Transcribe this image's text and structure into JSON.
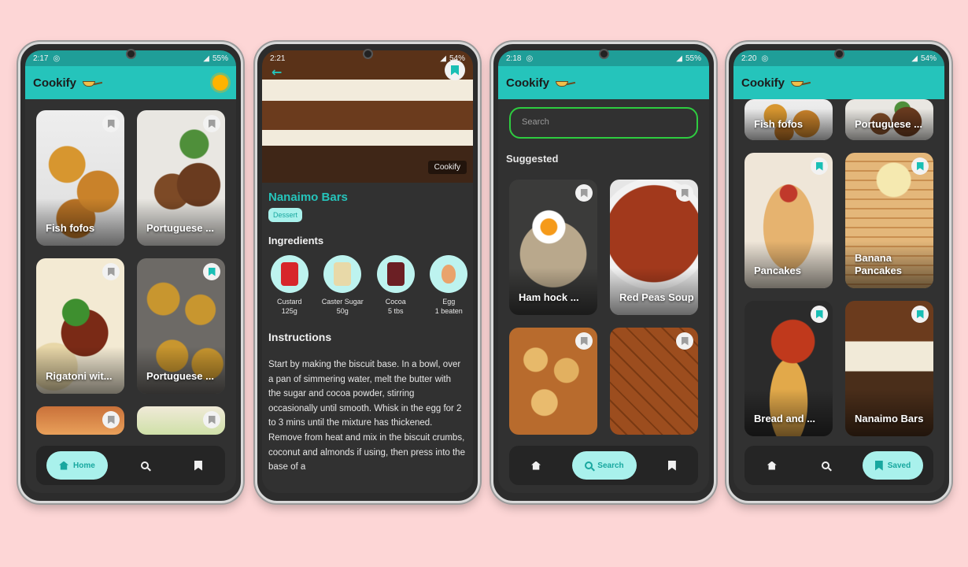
{
  "app_name": "Cookify",
  "phone1": {
    "status": {
      "time": "2:17",
      "battery": "55%"
    },
    "cards": [
      {
        "label": "Fish fofos",
        "saved": false
      },
      {
        "label": "Portuguese ...",
        "saved": false
      },
      {
        "label": "Rigatoni wit...",
        "saved": false
      },
      {
        "label": "Portuguese ...",
        "saved": true
      },
      {
        "label": "",
        "saved": false
      },
      {
        "label": "",
        "saved": false
      }
    ],
    "nav": {
      "home": "Home"
    }
  },
  "phone2": {
    "status": {
      "time": "2:21",
      "battery": "54%"
    },
    "watermark": "Cookify",
    "title": "Nanaimo Bars",
    "category": "Dessert",
    "ingredients_heading": "Ingredients",
    "ingredients": [
      {
        "name": "Custard",
        "qty": "125g"
      },
      {
        "name": "Caster Sugar",
        "qty": "50g"
      },
      {
        "name": "Cocoa",
        "qty": "5 tbs"
      },
      {
        "name": "Egg",
        "qty": "1 beaten"
      }
    ],
    "instructions_heading": "Instructions",
    "instructions": "Start by making the biscuit base. In a bowl, over a pan of simmering water, melt the butter with the sugar and cocoa powder, stirring occasionally until smooth. Whisk in the egg for 2 to 3 mins until the mixture has thickened. Remove from heat and mix in the biscuit crumbs, coconut and almonds if using, then press into the base of a"
  },
  "phone3": {
    "status": {
      "time": "2:18",
      "battery": "55%"
    },
    "search_placeholder": "Search",
    "suggested": "Suggested",
    "cards": [
      {
        "label": "Ham hock ...",
        "saved": false
      },
      {
        "label": "Red Peas Soup",
        "saved": false
      },
      {
        "label": "",
        "saved": false
      },
      {
        "label": "",
        "saved": false
      }
    ],
    "nav": {
      "search": "Search"
    }
  },
  "phone4": {
    "status": {
      "time": "2:20",
      "battery": "54%"
    },
    "cards": [
      {
        "label": "Fish fofos",
        "saved": true
      },
      {
        "label": "Portuguese ...",
        "saved": true
      },
      {
        "label": "Pancakes",
        "saved": true
      },
      {
        "label": "Banana Pancakes",
        "saved": true
      },
      {
        "label": "Bread and ...",
        "saved": true
      },
      {
        "label": "Nanaimo Bars",
        "saved": true
      }
    ],
    "nav": {
      "saved": "Saved"
    }
  },
  "colors": {
    "accent": "#25c4bb",
    "background": "#fdd6d6",
    "dark": "#313131"
  }
}
